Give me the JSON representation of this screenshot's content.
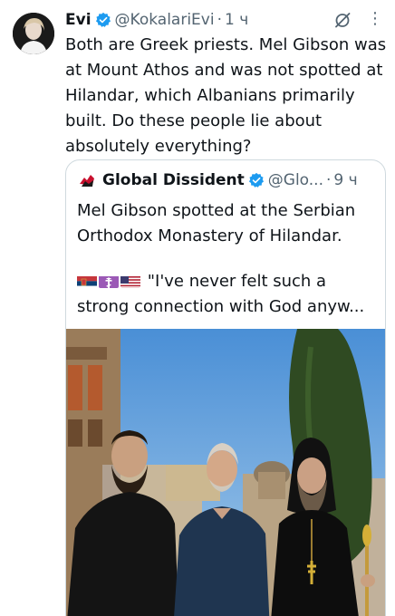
{
  "tweet": {
    "author_name": "Evi",
    "handle": "@KokalariEvi",
    "separator": "·",
    "time": "1 ч",
    "text": "Both are Greek priests. Mel Gibson was at Mount Athos and was not spotted at Hilandar, which Albanians primarily built. Do these people lie about absolutely everything?",
    "icons": [
      "verified-badge-icon",
      "grok-icon",
      "more-icon"
    ]
  },
  "quoted": {
    "author_name": "Global Dissident",
    "handle": "@Glo...",
    "separator": "·",
    "time": "9 ч",
    "text_line1": "Mel Gibson spotted at the Serbian Orthodox Monastery of Hilandar.",
    "text_line2": "\"I've never felt such a strong connection with God anyw...",
    "flags": [
      "serbia-flag-icon",
      "orthodox-cross-icon",
      "usa-flag-icon"
    ]
  },
  "colors": {
    "text": "#0f1419",
    "muted": "#536471",
    "verified": "#1d9bf0",
    "border": "#cfd9de"
  }
}
